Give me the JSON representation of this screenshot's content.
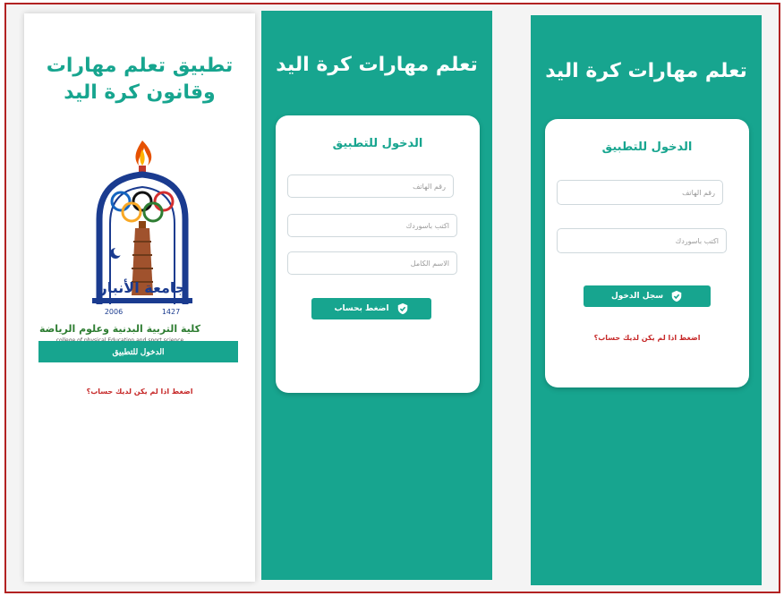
{
  "colors": {
    "brand": "#17a58f",
    "link": "#c62828",
    "frame": "#b22222"
  },
  "splash": {
    "title_line1": "تطبيق تعلم مهارات",
    "title_line2": "وقانون كرة اليد",
    "logo_text": "جامعة الأنبار",
    "logo_year_left": "2006",
    "logo_year_right": "1427",
    "college_ar": "كلية التربية البدنية وعلوم الرياضة",
    "college_en": "college of physical Education and sport science",
    "login_button": "الدخول للتطبيق",
    "register_link": "اضغط اذا لم يكن لديك حساب؟"
  },
  "register": {
    "title": "تعلم مهارات كرة اليد",
    "card_title": "الدخول للتطبيق",
    "phone_placeholder": "رقم الهاتف",
    "password_placeholder": "اكتب باسوردك",
    "fullname_placeholder": "الاسم الكامل",
    "submit_button": "اضغط بحساب",
    "button_icon": "shield-check-icon"
  },
  "login": {
    "title": "تعلم مهارات كرة اليد",
    "card_title": "الدخول للتطبيق",
    "phone_placeholder": "رقم الهاتف",
    "password_placeholder": "اكتب باسوردك",
    "submit_button": "سجل الدخول",
    "button_icon": "shield-check-icon",
    "register_link": "اضغط اذا لم يكن لديك حساب؟"
  }
}
